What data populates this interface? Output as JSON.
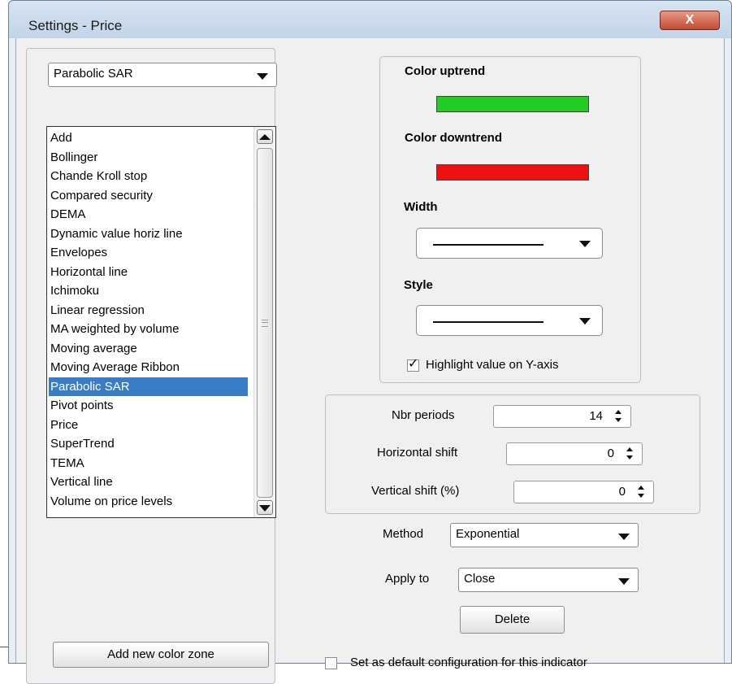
{
  "window": {
    "title": "Settings - Price",
    "close_symbol": "X"
  },
  "indicator_select": {
    "selected": "Parabolic SAR"
  },
  "indicator_list": {
    "items": [
      "Add",
      "Bollinger",
      "Chande Kroll stop",
      "Compared security",
      "DEMA",
      "Dynamic value horiz line",
      "Envelopes",
      "Horizontal line",
      "Ichimoku",
      "Linear regression",
      "MA weighted by volume",
      "Moving average",
      "Moving Average Ribbon",
      "Parabolic SAR",
      "Pivot points",
      "Price",
      "SuperTrend",
      "TEMA",
      "Vertical line",
      "Volume on price levels"
    ],
    "selected_index": 13
  },
  "add_zone_label": "Add new color zone",
  "appearance": {
    "color_up_label": "Color uptrend",
    "color_up": "#22cc22",
    "color_down_label": "Color downtrend",
    "color_down": "#ee1111",
    "width_label": "Width",
    "style_label": "Style",
    "highlight_label": "Highlight value on Y-axis",
    "highlight_checked": true,
    "check_mark": "✓"
  },
  "params": {
    "nbr_periods_label": "Nbr periods",
    "nbr_periods": "14",
    "hshift_label": "Horizontal shift",
    "hshift": "0",
    "vshift_label": "Vertical shift (%)",
    "vshift": "0"
  },
  "method": {
    "label": "Method",
    "value": "Exponential"
  },
  "apply_to": {
    "label": "Apply to",
    "value": "Close"
  },
  "delete_label": "Delete",
  "default_config_label": "Set as default configuration for this indicator"
}
